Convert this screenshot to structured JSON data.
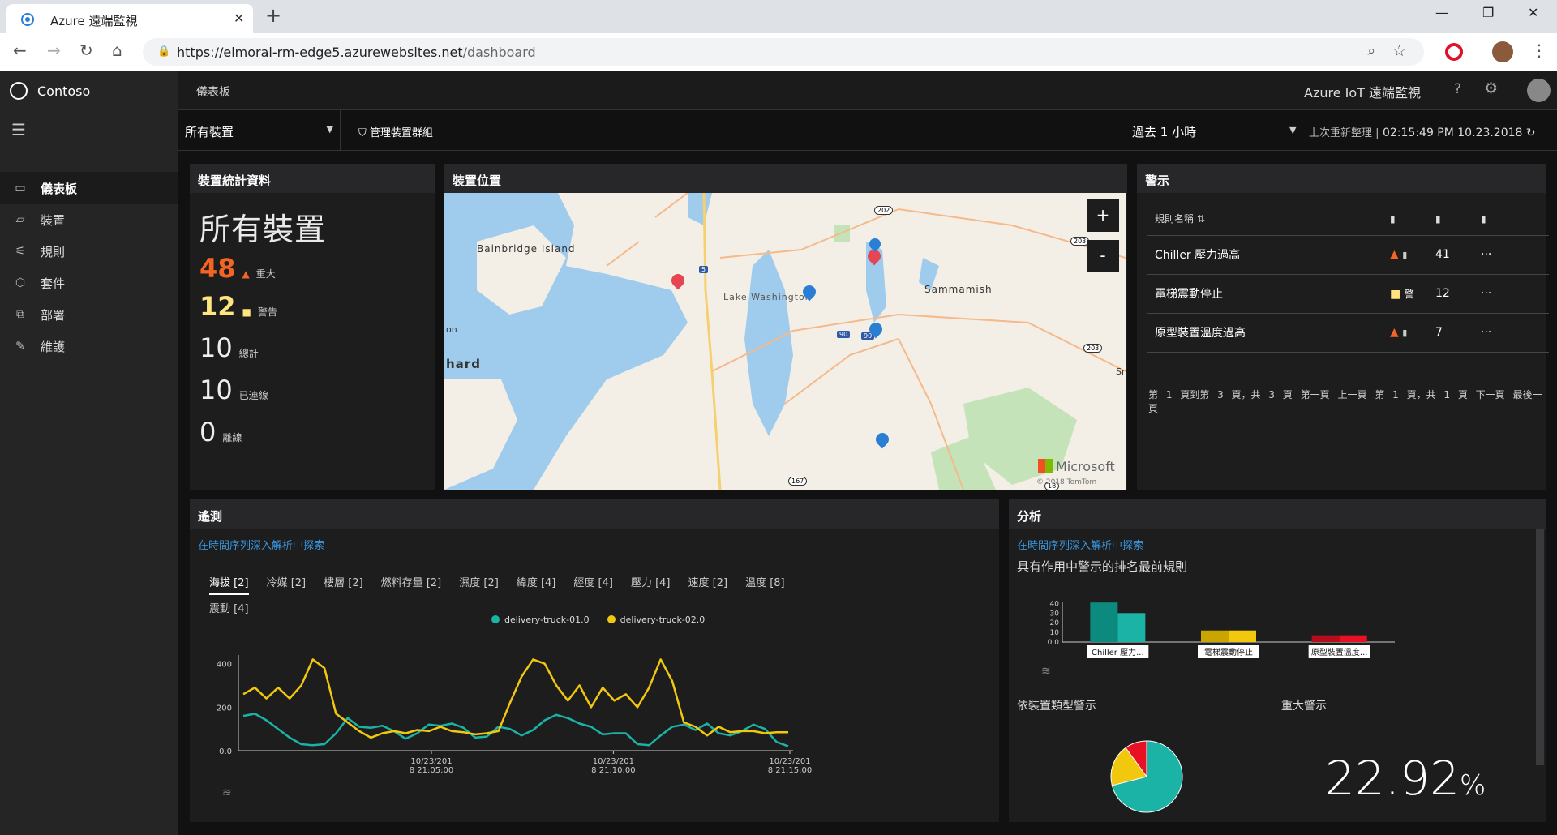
{
  "browser": {
    "tab_title": "Azure 遠端監視",
    "url_host": "https://elmoral-rm-edge5.azurewebsites.net",
    "url_path": "/dashboard"
  },
  "sidebar": {
    "brand": "Contoso",
    "items": [
      {
        "label": "儀表板",
        "icon": "dashboard-icon",
        "active": true
      },
      {
        "label": "裝置",
        "icon": "device-icon"
      },
      {
        "label": "規則",
        "icon": "rules-icon"
      },
      {
        "label": "套件",
        "icon": "package-icon"
      },
      {
        "label": "部署",
        "icon": "deploy-icon"
      },
      {
        "label": "維護",
        "icon": "maintenance-icon"
      }
    ]
  },
  "topbar": {
    "breadcrumb": "儀表板",
    "app_title": "Azure IoT 遠端監視",
    "help": "?",
    "gear": "⚙"
  },
  "filters": {
    "device_group": "所有裝置",
    "manage_groups": "管理裝置群組",
    "time_range": "過去 1 小時",
    "refresh_label": "上次重新整理 |",
    "refresh_time": "02:15:49 PM 10.23.2018"
  },
  "stats": {
    "title": "裝置統計資料",
    "heading": "所有裝置",
    "critical": {
      "value": "48",
      "label": "重大"
    },
    "warning": {
      "value": "12",
      "label": "警告"
    },
    "total": {
      "value": "10",
      "label": "總計"
    },
    "connected": {
      "value": "10",
      "label": "已連線"
    },
    "offline": {
      "value": "0",
      "label": "離線"
    }
  },
  "map": {
    "title": "裝置位置",
    "zoom_in": "+",
    "zoom_out": "-",
    "labels": [
      "Bainbridge Island",
      "Lake Washington",
      "Sammamish",
      "hard",
      "on",
      "Sn"
    ],
    "road_badges": [
      "202",
      "203",
      "203",
      "5",
      "90",
      "90",
      "167",
      "18"
    ],
    "attribution": "Microsoft",
    "copyright": "© 2018 TomTom"
  },
  "alerts": {
    "title": "警示",
    "col_rule": "規則名稱 ⇅",
    "col_severity": "▮",
    "col_count": "▮",
    "col_more": "▮",
    "rows": [
      {
        "name": "Chiller 壓力過高",
        "severity": "critical",
        "count": "41",
        "more": "···"
      },
      {
        "name": "電梯震動停止",
        "severity": "warning",
        "status": "警",
        "count": "12",
        "more": "···"
      },
      {
        "name": "原型裝置溫度過高",
        "severity": "critical",
        "count": "7",
        "more": "···"
      }
    ],
    "pager": {
      "summary": "第 1 頁到第 3 頁，共 3 頁",
      "first": "第一頁",
      "prev": "上一頁",
      "page": "第 1 頁，共 1 頁",
      "next": "下一頁",
      "last": "最後一頁"
    }
  },
  "telemetry": {
    "title": "遙測",
    "explore_link": "在時間序列深入解析中探索",
    "tabs": [
      "海拔 [2]",
      "冷媒 [2]",
      "樓層 [2]",
      "燃料存量 [2]",
      "濕度 [2]",
      "緯度 [4]",
      "經度 [4]",
      "壓力 [4]",
      "速度 [2]",
      "溫度 [8]",
      "震動 [4]"
    ]
  },
  "analytics": {
    "title": "分析",
    "explore_link": "在時間序列深入解析中探索",
    "top_rules_title": "具有作用中警示的排名最前規則",
    "by_type_title": "依裝置類型警示",
    "critical_title": "重大警示",
    "critical_value": "22.92",
    "critical_unit": "%"
  },
  "colors": {
    "teal": "#1ab3a6",
    "yellow": "#f2c80f",
    "critical": "#f26522",
    "warning": "#ffe57f",
    "red": "#e81123",
    "link": "#3a96dd"
  },
  "chart_data": [
    {
      "type": "line",
      "title": "",
      "series": [
        {
          "name": "delivery-truck-01.0",
          "color": "#1ab3a6",
          "values": [
            160,
            170,
            140,
            100,
            60,
            30,
            25,
            30,
            80,
            150,
            110,
            105,
            115,
            90,
            55,
            80,
            120,
            115,
            125,
            105,
            60,
            65,
            110,
            100,
            70,
            95,
            140,
            165,
            150,
            125,
            110,
            75,
            80,
            80,
            30,
            25,
            70,
            110,
            120,
            95,
            125,
            80,
            70,
            90,
            120,
            100,
            40,
            20
          ]
        },
        {
          "name": "delivery-truck-02.0",
          "color": "#f2c80f",
          "values": [
            260,
            290,
            240,
            290,
            240,
            300,
            420,
            380,
            170,
            130,
            90,
            60,
            80,
            90,
            80,
            95,
            90,
            110,
            90,
            85,
            75,
            80,
            90,
            220,
            340,
            420,
            400,
            300,
            230,
            300,
            200,
            290,
            230,
            260,
            200,
            290,
            420,
            320,
            130,
            110,
            70,
            110,
            85,
            90,
            90,
            80,
            85,
            85
          ]
        }
      ],
      "x_ticks": [
        "10/23/2018 21:05:00",
        "10/23/2018 21:10:00",
        "10/23/2018 21:15:00"
      ],
      "y_ticks": [
        "400",
        "200",
        "0.0"
      ],
      "ylim": [
        0,
        440
      ]
    },
    {
      "type": "bar",
      "title": "具有作用中警示的排名最前規則",
      "categories": [
        "Chiller 壓力...",
        "電梯震動停止",
        "原型裝置溫度..."
      ],
      "series": [
        {
          "values": [
            41,
            12,
            7
          ],
          "colors": [
            "#0d8a7e",
            "#c9a500",
            "#b50d1c"
          ]
        },
        {
          "values": [
            30,
            12,
            7
          ],
          "colors": [
            "#1ab3a6",
            "#f2c80f",
            "#e81123"
          ]
        }
      ],
      "y_ticks": [
        "40",
        "30",
        "20",
        "10",
        "0.0"
      ],
      "ylim": [
        0,
        42
      ]
    },
    {
      "type": "pie",
      "title": "依裝置類型警示",
      "slices": [
        {
          "value": 71,
          "color": "#1ab3a6"
        },
        {
          "value": 19,
          "color": "#f2c80f"
        },
        {
          "value": 10,
          "color": "#e81123"
        }
      ]
    }
  ]
}
